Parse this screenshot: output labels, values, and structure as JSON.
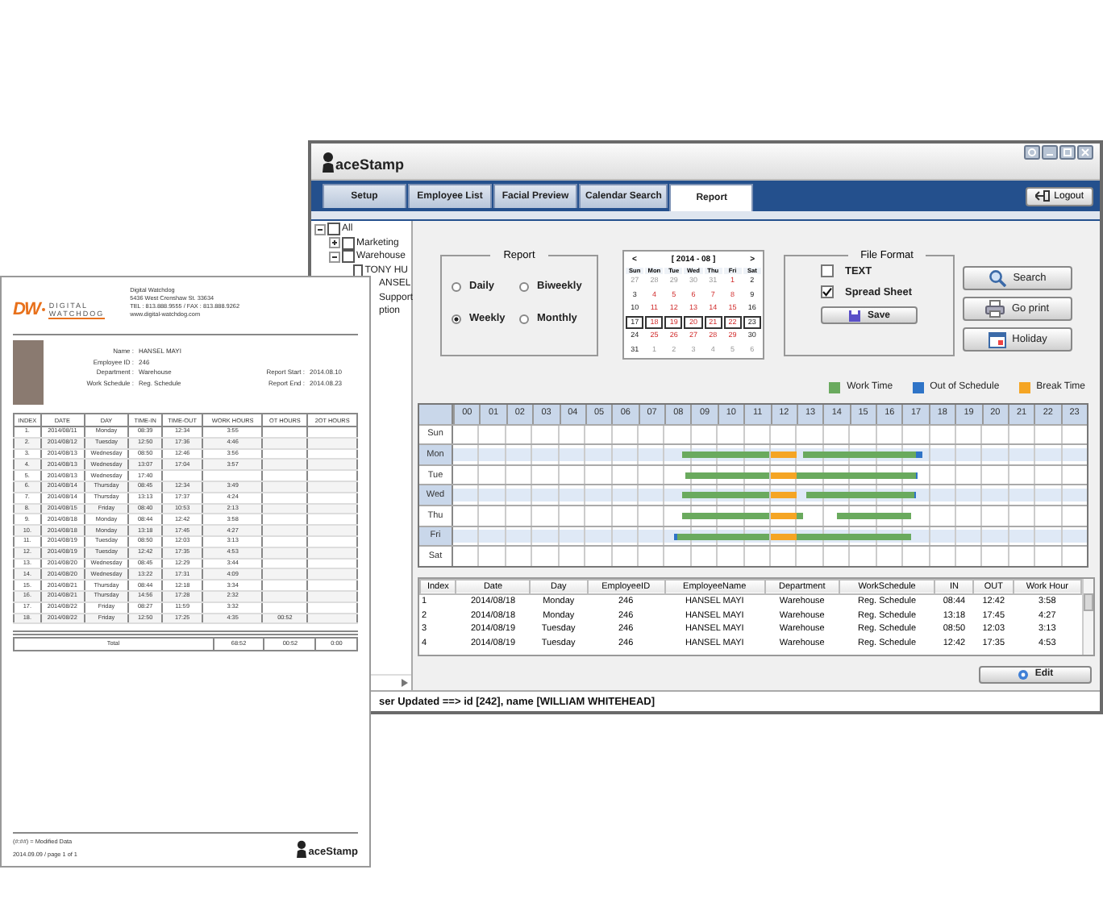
{
  "report_document": {
    "logo": {
      "mark": "DW",
      "line1": "DIGITAL",
      "line2": "WATCHDOG"
    },
    "company": [
      "Digital Watchdog",
      "5436 West Crenshaw St. 33634",
      "TEL : 813.888.9555  /  FAX : 813.888.9262",
      "www.digital-watchdog.com"
    ],
    "fields": [
      {
        "label": "Name :",
        "value": "HANSEL MAYI"
      },
      {
        "label": "Employee ID :",
        "value": "246"
      },
      {
        "label": "Department :",
        "value": "Warehouse"
      },
      {
        "label": "Work Schedule :",
        "value": "Reg. Schedule"
      }
    ],
    "period": [
      {
        "label": "Report Start :",
        "value": "2014.08.10"
      },
      {
        "label": "Report End :",
        "value": "2014.08.23"
      }
    ],
    "columns": [
      "INDEX",
      "DATE",
      "DAY",
      "TIME-IN",
      "TIME-OUT",
      "WORK HOURS",
      "OT HOURS",
      "2OT HOURS"
    ],
    "rows": [
      {
        "index": "1.",
        "date": "2014/08/11",
        "day": "Monday",
        "time_in": "08:39",
        "time_out": "12:34",
        "work_hours": "3:55"
      },
      {
        "index": "2.",
        "date": "2014/08/12",
        "day": "Tuesday",
        "time_in": "12:50",
        "time_out": "17:36",
        "work_hours": "4:46"
      },
      {
        "index": "3.",
        "date": "2014/08/13",
        "day": "Wednesday",
        "time_in": "08:50",
        "time_out": "12:46",
        "work_hours": "3:56"
      },
      {
        "index": "4.",
        "date": "2014/08/13",
        "day": "Wednesday",
        "time_in": "13:07",
        "time_out": "17:04",
        "work_hours": "3:57"
      },
      {
        "index": "5.",
        "date": "2014/08/13",
        "day": "Wednesday",
        "time_in": "17:40"
      },
      {
        "index": "6.",
        "date": "2014/08/14",
        "day": "Thursday",
        "time_in": "08:45",
        "time_out": "12:34",
        "work_hours": "3:49"
      },
      {
        "index": "7.",
        "date": "2014/08/14",
        "day": "Thursday",
        "time_in": "13:13",
        "time_out": "17:37",
        "work_hours": "4:24"
      },
      {
        "index": "8.",
        "date": "2014/08/15",
        "day": "Friday",
        "time_in": "08:40",
        "time_out": "10:53",
        "work_hours": "2:13"
      },
      {
        "index": "9.",
        "date": "2014/08/18",
        "day": "Monday",
        "time_in": "08:44",
        "time_out": "12:42",
        "work_hours": "3:58"
      },
      {
        "index": "10.",
        "date": "2014/08/18",
        "day": "Monday",
        "time_in": "13:18",
        "time_out": "17:45",
        "work_hours": "4:27"
      },
      {
        "index": "11.",
        "date": "2014/08/19",
        "day": "Tuesday",
        "time_in": "08:50",
        "time_out": "12:03",
        "work_hours": "3:13"
      },
      {
        "index": "12.",
        "date": "2014/08/19",
        "day": "Tuesday",
        "time_in": "12:42",
        "time_out": "17:35",
        "work_hours": "4:53"
      },
      {
        "index": "13.",
        "date": "2014/08/20",
        "day": "Wednesday",
        "time_in": "08:45",
        "time_out": "12:29",
        "work_hours": "3:44"
      },
      {
        "index": "14.",
        "date": "2014/08/20",
        "day": "Wednesday",
        "time_in": "13:22",
        "time_out": "17:31",
        "work_hours": "4:09"
      },
      {
        "index": "15.",
        "date": "2014/08/21",
        "day": "Thursday",
        "time_in": "08:44",
        "time_out": "12:18",
        "work_hours": "3:34"
      },
      {
        "index": "16.",
        "date": "2014/08/21",
        "day": "Thursday",
        "time_in": "14:56",
        "time_out": "17:28",
        "work_hours": "2:32"
      },
      {
        "index": "17.",
        "date": "2014/08/22",
        "day": "Friday",
        "time_in": "08:27",
        "time_out": "11:59",
        "work_hours": "3:32"
      },
      {
        "index": "18.",
        "date": "2014/08/22",
        "day": "Friday",
        "time_in": "12:50",
        "time_out": "17:25",
        "work_hours": "4:35",
        "ot_hours": "00:52"
      }
    ],
    "total": {
      "label": "Total",
      "values": [
        "68:52",
        "00:52",
        "0:00"
      ]
    },
    "footnote": "(#:##) = Modified Data",
    "footer": "2014.09.09  /  page 1 of 1",
    "footer_logo": "aceStamp"
  },
  "app": {
    "logo": "aceStamp",
    "tabs": [
      {
        "label": "Setup",
        "selected": false
      },
      {
        "label": "Employee List",
        "selected": false
      },
      {
        "label": "Facial Preview",
        "selected": false
      },
      {
        "label": "Calendar Search",
        "selected": false
      },
      {
        "label": "Report",
        "selected": true
      }
    ],
    "logout": "Logout",
    "tree": [
      {
        "label": "All",
        "checked": false,
        "expanded": true,
        "children": [
          {
            "label": "Marketing",
            "checked": false,
            "expanded": false
          },
          {
            "label": "Warehouse",
            "checked": false,
            "expanded": true,
            "children": [
              {
                "label": "TONY HU",
                "checked": false
              },
              {
                "label": "ANSEL",
                "kind": "partial"
              }
            ]
          },
          {
            "label": "Support",
            "kind": "partial"
          },
          {
            "label": "ption",
            "kind": "partial"
          }
        ]
      }
    ],
    "report_group": {
      "title": "Report",
      "options": [
        {
          "label": "Daily",
          "selected": false
        },
        {
          "label": "Biweekly",
          "selected": false
        },
        {
          "label": "Weekly",
          "selected": true
        },
        {
          "label": "Monthly",
          "selected": false
        }
      ]
    },
    "calendar": {
      "prev": "<",
      "title": "[ 2014 - 08 ]",
      "next": ">",
      "weekdays": [
        "Sun",
        "Mon",
        "Tue",
        "Wed",
        "Thu",
        "Fri",
        "Sat"
      ],
      "weeks": [
        {
          "selected": false,
          "days": [
            {
              "d": "27",
              "muted": true
            },
            {
              "d": "28",
              "muted": true
            },
            {
              "d": "29",
              "muted": true
            },
            {
              "d": "30",
              "muted": true
            },
            {
              "d": "31",
              "muted": true
            },
            {
              "d": "1",
              "muted": false
            },
            {
              "d": "2",
              "muted": false
            }
          ]
        },
        {
          "selected": false,
          "days": [
            {
              "d": "3",
              "muted": false
            },
            {
              "d": "4",
              "muted": false
            },
            {
              "d": "5",
              "muted": false
            },
            {
              "d": "6",
              "muted": false
            },
            {
              "d": "7",
              "muted": false
            },
            {
              "d": "8",
              "muted": false
            },
            {
              "d": "9",
              "muted": false
            }
          ]
        },
        {
          "selected": false,
          "days": [
            {
              "d": "10",
              "muted": false
            },
            {
              "d": "11",
              "muted": false
            },
            {
              "d": "12",
              "muted": false
            },
            {
              "d": "13",
              "muted": false
            },
            {
              "d": "14",
              "muted": false
            },
            {
              "d": "15",
              "muted": false
            },
            {
              "d": "16",
              "muted": false
            }
          ]
        },
        {
          "selected": true,
          "days": [
            {
              "d": "17",
              "muted": false
            },
            {
              "d": "18",
              "muted": false
            },
            {
              "d": "19",
              "muted": false
            },
            {
              "d": "20",
              "muted": false
            },
            {
              "d": "21",
              "muted": false
            },
            {
              "d": "22",
              "muted": false
            },
            {
              "d": "23",
              "muted": false
            }
          ]
        },
        {
          "selected": false,
          "days": [
            {
              "d": "24",
              "muted": false
            },
            {
              "d": "25",
              "muted": false
            },
            {
              "d": "26",
              "muted": false
            },
            {
              "d": "27",
              "muted": false
            },
            {
              "d": "28",
              "muted": false
            },
            {
              "d": "29",
              "muted": false
            },
            {
              "d": "30",
              "muted": false
            }
          ]
        },
        {
          "selected": false,
          "days": [
            {
              "d": "31",
              "muted": false
            },
            {
              "d": "1",
              "muted": true
            },
            {
              "d": "2",
              "muted": true
            },
            {
              "d": "3",
              "muted": true
            },
            {
              "d": "4",
              "muted": true
            },
            {
              "d": "5",
              "muted": true
            },
            {
              "d": "6",
              "muted": true
            }
          ]
        }
      ]
    },
    "file_format": {
      "title": "File Format",
      "options": [
        {
          "label": "TEXT",
          "checked": false
        },
        {
          "label": "Spread Sheet",
          "checked": true
        }
      ],
      "save": "Save"
    },
    "actions": [
      {
        "label": "Search",
        "kind": "search"
      },
      {
        "label": "Go print",
        "kind": "print"
      },
      {
        "label": "Holiday",
        "kind": "calendar"
      }
    ],
    "legend": [
      {
        "label": "Work Time",
        "kind": "work",
        "color": "#6aaa5e"
      },
      {
        "label": "Out of Schedule",
        "kind": "out",
        "color": "#2f74c7"
      },
      {
        "label": "Break Time",
        "kind": "break",
        "color": "#f5a524"
      }
    ],
    "schedule": {
      "hours": [
        "00",
        "01",
        "02",
        "03",
        "04",
        "05",
        "06",
        "07",
        "08",
        "09",
        "10",
        "11",
        "12",
        "13",
        "14",
        "15",
        "16",
        "17",
        "18",
        "19",
        "20",
        "21",
        "22",
        "23"
      ],
      "days": [
        "Sun",
        "Mon",
        "Tue",
        "Wed",
        "Thu",
        "Fri",
        "Sat"
      ]
    },
    "table": {
      "columns": [
        "Index",
        "Date",
        "Day",
        "EmployeeID",
        "EmployeeName",
        "Department",
        "WorkSchedule",
        "IN",
        "OUT",
        "Work Hour"
      ],
      "rows": [
        [
          "1",
          "2014/08/18",
          "Monday",
          "246",
          "HANSEL MAYI",
          "Warehouse",
          "Reg. Schedule",
          "08:44",
          "12:42",
          "3:58"
        ],
        [
          "2",
          "2014/08/18",
          "Monday",
          "246",
          "HANSEL MAYI",
          "Warehouse",
          "Reg. Schedule",
          "13:18",
          "17:45",
          "4:27"
        ],
        [
          "3",
          "2014/08/19",
          "Tuesday",
          "246",
          "HANSEL MAYI",
          "Warehouse",
          "Reg. Schedule",
          "08:50",
          "12:03",
          "3:13"
        ],
        [
          "4",
          "2014/08/19",
          "Tuesday",
          "246",
          "HANSEL MAYI",
          "Warehouse",
          "Reg. Schedule",
          "12:42",
          "17:35",
          "4:53"
        ]
      ]
    },
    "edit": "Edit",
    "status": "ser Updated ==> id [242], name [WILLIAM WHITEHEAD]"
  }
}
